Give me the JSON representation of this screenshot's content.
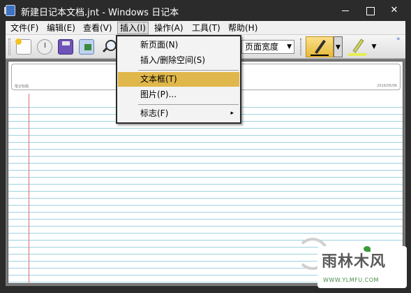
{
  "window": {
    "title": "新建日记本文档.jnt - Windows 日记本",
    "minimize": "",
    "maximize": "",
    "close": "✕"
  },
  "menubar": {
    "items": [
      {
        "label": "文件(F)"
      },
      {
        "label": "编辑(E)"
      },
      {
        "label": "查看(V)"
      },
      {
        "label": "插入(I)"
      },
      {
        "label": "操作(A)"
      },
      {
        "label": "工具(T)"
      },
      {
        "label": "帮助(H)"
      }
    ],
    "open_index": 3
  },
  "toolbar": {
    "zoom": {
      "value": "页面宽度",
      "arrow": "▼"
    },
    "pen_drop": "▼",
    "highlighter_drop": "▼",
    "more": "»",
    "icons": [
      "new-page-icon",
      "clock-icon",
      "save-icon",
      "export-icon",
      "find-icon",
      "pen-icon",
      "highlighter-icon"
    ]
  },
  "insert_menu": {
    "items": [
      {
        "label": "新页面(N)",
        "highlighted": false
      },
      {
        "label": "插入/删除空间(S)",
        "highlighted": false
      },
      {
        "label": "文本框(T)",
        "highlighted": true
      },
      {
        "label": "图片(P)...",
        "highlighted": false
      },
      {
        "label": "标志(F)",
        "highlighted": false,
        "submenu": "▸"
      }
    ]
  },
  "page": {
    "title_caption_left": "笔记标题",
    "title_caption_right": "2016/05/06"
  },
  "watermark": {
    "brand": "雨林木风",
    "url": "WWW.YLMFU.COM"
  },
  "colors": {
    "titlebar": "#2b2b2b",
    "menu_highlight": "#e0b74a",
    "rule_line": "#9fd2e0",
    "margin_line": "#e06a6a"
  }
}
